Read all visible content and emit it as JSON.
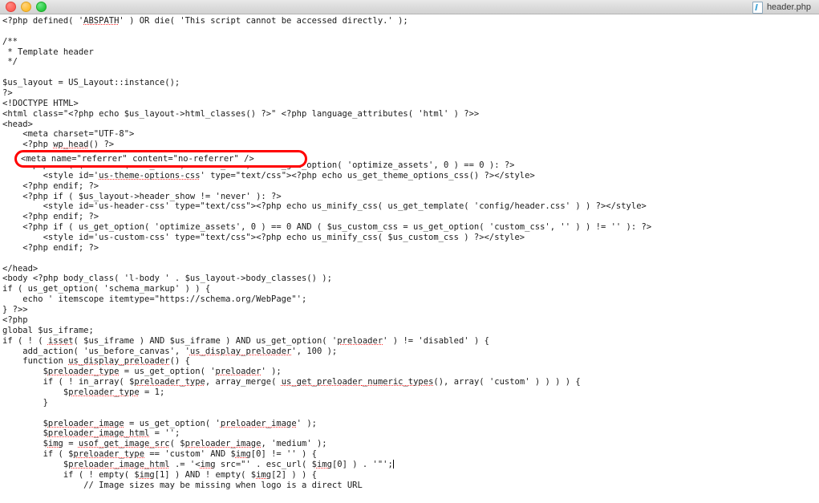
{
  "window": {
    "title": "header.php",
    "doc_icon": "php-file-icon",
    "traffic_lights": [
      {
        "name": "close-button",
        "color": "#ff5f57"
      },
      {
        "name": "minimize-button",
        "color": "#ffbd2e"
      },
      {
        "name": "zoom-button",
        "color": "#28c940"
      }
    ]
  },
  "annotation": {
    "shape": "rounded-rectangle",
    "color": "#ff0000",
    "text": "<meta name=\"referrer\" content=\"no-referrer\" />"
  },
  "editor": {
    "language": "php",
    "caret_visible": true,
    "lines": [
      "<?php defined( 'ABSPATH' ) OR die( 'This script cannot be accessed directly.' );",
      "",
      "/**",
      " * Template header",
      " */",
      "",
      "$us_layout = US_Layout::instance();",
      "?>",
      "<!DOCTYPE HTML>",
      "<html class=\"<?php echo $us_layout->html_classes() ?>\" <?php language_attributes( 'html' ) ?>>",
      "<head>",
      "\t<meta charset=\"UTF-8\">",
      "\t<?php wp_head() ?>",
      "",
      "\t<?php if ( ( defined( 'US_DEV' ) AND US_DEV ) OR us_get_option( 'optimize_assets', 0 ) == 0 ): ?>",
      "\t\t<style id='us-theme-options-css' type=\"text/css\"><?php echo us_get_theme_options_css() ?></style>",
      "\t<?php endif; ?>",
      "\t<?php if ( $us_layout->header_show != 'never' ): ?>",
      "\t\t<style id='us-header-css' type=\"text/css\"><?php echo us_minify_css( us_get_template( 'config/header.css' ) ) ?></style>",
      "\t<?php endif; ?>",
      "\t<?php if ( us_get_option( 'optimize_assets', 0 ) == 0 AND ( $us_custom_css = us_get_option( 'custom_css', '' ) ) != '' ): ?>",
      "\t\t<style id='us-custom-css' type=\"text/css\"><?php echo us_minify_css( $us_custom_css ) ?></style>",
      "\t<?php endif; ?>",
      "",
      "</head>",
      "<body <?php body_class( 'l-body ' . $us_layout->body_classes() );",
      "if ( us_get_option( 'schema_markup' ) ) {",
      "\techo ' itemscope itemtype=\"https://schema.org/WebPage\"';",
      "} ?>>",
      "<?php",
      "global $us_iframe;",
      "if ( ! ( isset( $us_iframe ) AND $us_iframe ) AND us_get_option( 'preloader' ) != 'disabled' ) {",
      "\tadd_action( 'us_before_canvas', 'us_display_preloader', 100 );",
      "\tfunction us_display_preloader() {",
      "\t\t$preloader_type = us_get_option( 'preloader' );",
      "\t\tif ( ! in_array( $preloader_type, array_merge( us_get_preloader_numeric_types(), array( 'custom' ) ) ) ) {",
      "\t\t\t$preloader_type = 1;",
      "\t\t}",
      "",
      "\t\t$preloader_image = us_get_option( 'preloader_image' );",
      "\t\t$preloader_image_html = '';",
      "\t\t$img = usof_get_image_src( $preloader_image, 'medium' );",
      "\t\tif ( $preloader_type == 'custom' AND $img[0] != '' ) {",
      "\t\t\t$preloader_image_html .= '<img src=\"' . esc_url( $img[0] ) . '\"';",
      "\t\t\tif ( ! empty( $img[1] ) AND ! empty( $img[2] ) ) {",
      "\t\t\t\t// Image sizes may be missing when logo is a direct URL"
    ],
    "misspelled_words": [
      "ABSPATH",
      "us-theme-options-css",
      "wp_head",
      "isset",
      "preloader",
      "us_display_preloader",
      "preloader_type",
      "us_get_preloader_numeric_types",
      "preloader_image",
      "preloader_image_html",
      "img",
      "usof_get_image_src"
    ]
  }
}
